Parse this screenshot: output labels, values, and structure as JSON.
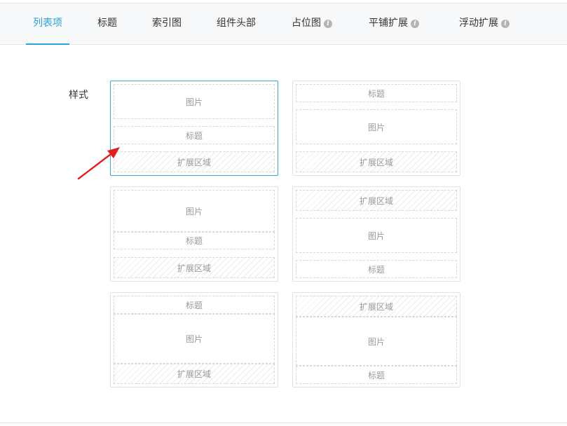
{
  "tabs": [
    {
      "label": "列表项",
      "active": true,
      "info": false
    },
    {
      "label": "标题",
      "active": false,
      "info": false
    },
    {
      "label": "索引图",
      "active": false,
      "info": false
    },
    {
      "label": "组件头部",
      "active": false,
      "info": false
    },
    {
      "label": "占位图",
      "active": false,
      "info": true
    },
    {
      "label": "平铺扩展",
      "active": false,
      "info": true
    },
    {
      "label": "浮动扩展",
      "active": false,
      "info": true
    }
  ],
  "info_icon_glyph": "i",
  "style_label": "样式",
  "blocks": {
    "image": "图片",
    "title": "标题",
    "ext": "扩展区域"
  },
  "layouts": [
    {
      "id": "image-title-ext",
      "order": [
        "image",
        "title",
        "ext"
      ],
      "selected": true
    },
    {
      "id": "title-image-ext",
      "order": [
        "title",
        "image",
        "ext"
      ],
      "selected": false
    },
    {
      "id": "image-title-ext-alt",
      "order": [
        "image",
        "title",
        "ext"
      ],
      "selected": false
    },
    {
      "id": "ext-image-title",
      "order": [
        "ext",
        "image",
        "title"
      ],
      "selected": false
    },
    {
      "id": "title-image-ext-tall",
      "order": [
        "title",
        "image",
        "ext"
      ],
      "selected": false
    },
    {
      "id": "ext-image-title-tall",
      "order": [
        "ext",
        "image",
        "title"
      ],
      "selected": false
    }
  ],
  "colors": {
    "accent": "#29a3d8",
    "arrow": "#e02020",
    "tabbar_bg": "#f7f8fa"
  }
}
